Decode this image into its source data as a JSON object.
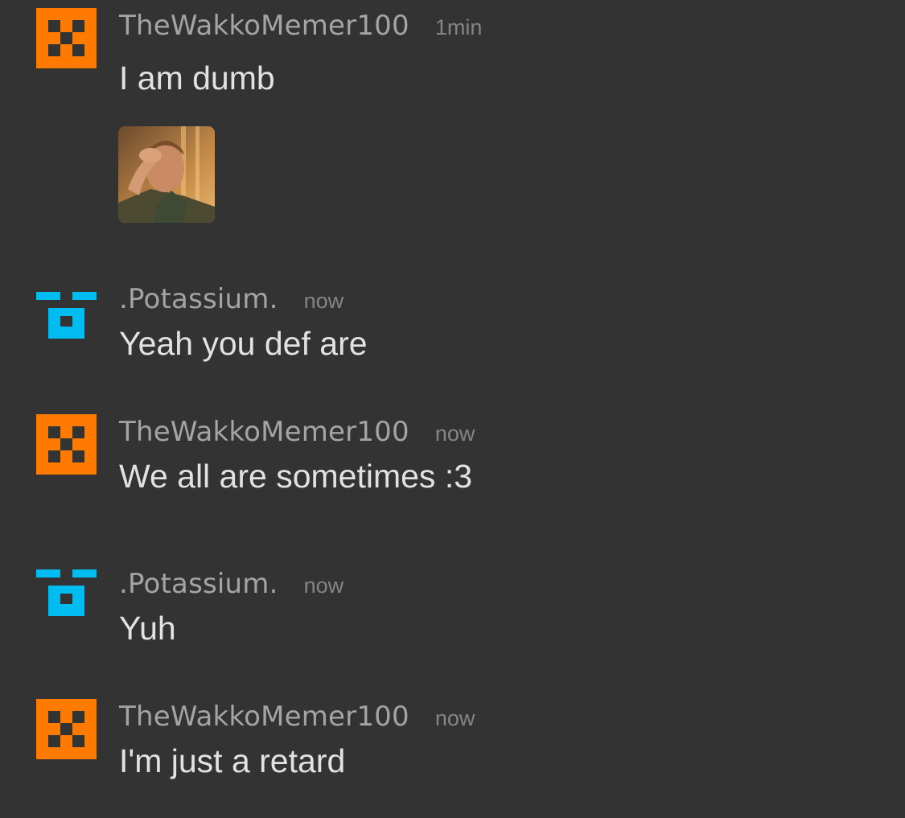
{
  "messages": [
    {
      "username": "TheWakkoMemer100",
      "time": "1min",
      "text": "I am dumb",
      "avatar_icon": "orange-pixel-face-icon",
      "avatar_color": "#ff7a00",
      "has_image": true,
      "image_icon": "facepalm-photo"
    },
    {
      "username": ".Potassium.",
      "time": "now",
      "text": "Yeah you def are",
      "avatar_icon": "blue-pixel-face-icon",
      "avatar_color": "#00bcf0"
    },
    {
      "username": "TheWakkoMemer100",
      "time": "now",
      "text": "We all are sometimes :3",
      "avatar_icon": "orange-pixel-face-icon",
      "avatar_color": "#ff7a00"
    },
    {
      "username": ".Potassium.",
      "time": "now",
      "text": "Yuh",
      "avatar_icon": "blue-pixel-face-icon",
      "avatar_color": "#00bcf0"
    },
    {
      "username": "TheWakkoMemer100",
      "time": "now",
      "text": "I'm just a retard",
      "avatar_icon": "orange-pixel-face-icon",
      "avatar_color": "#ff7a00"
    }
  ],
  "colors": {
    "background": "#333333",
    "username": "#a4a4a4",
    "time": "#858585",
    "text": "#e2e2e2"
  }
}
